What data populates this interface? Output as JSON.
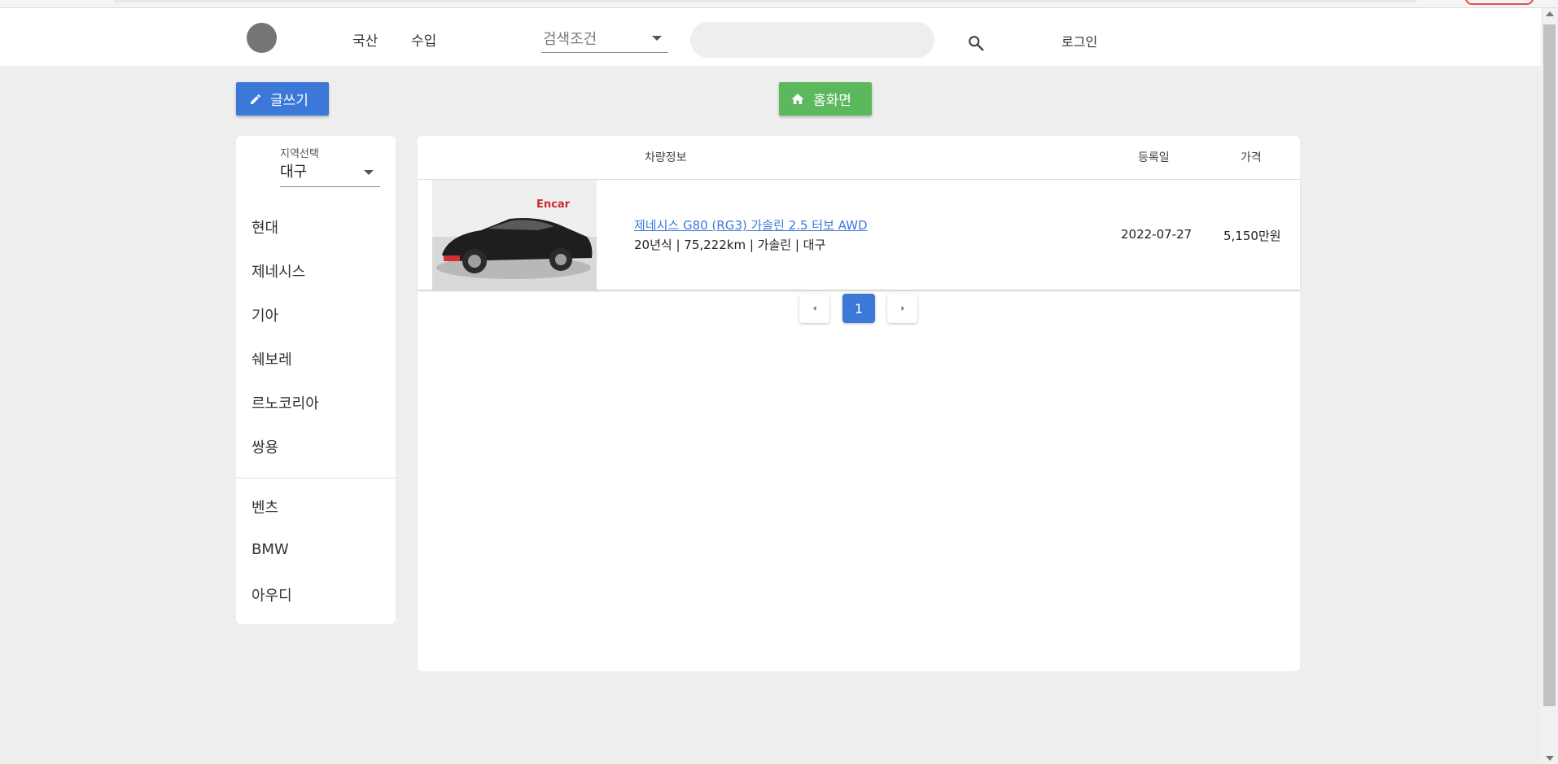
{
  "header": {
    "nav": [
      "국산",
      "수입"
    ],
    "search_condition": "검색조건",
    "search_placeholder": "",
    "login_label": "로그인"
  },
  "actions": {
    "write_label": "글쓰기",
    "home_label": "홈화면"
  },
  "sidebar": {
    "region_label": "지역선택",
    "region_value": "대구",
    "domestic_brands": [
      "현대",
      "제네시스",
      "기아",
      "쉐보레",
      "르노코리아",
      "쌍용"
    ],
    "import_brands": [
      "벤츠",
      "BMW",
      "아우디"
    ]
  },
  "table": {
    "columns": [
      "차량정보",
      "등록일",
      "가격"
    ],
    "rows": [
      {
        "image_alt": "Encar",
        "title": "제네시스 G80 (RG3) 가솔린 2.5 터보 AWD",
        "info": "20년식 | 75,222km | 가솔린 | 대구",
        "date": "2022-07-27",
        "price": "5,150만원"
      }
    ]
  },
  "pagination": {
    "current": "1"
  },
  "colors": {
    "primary": "#3b78d8",
    "success": "#5cb85c",
    "background": "#eeeeee"
  }
}
